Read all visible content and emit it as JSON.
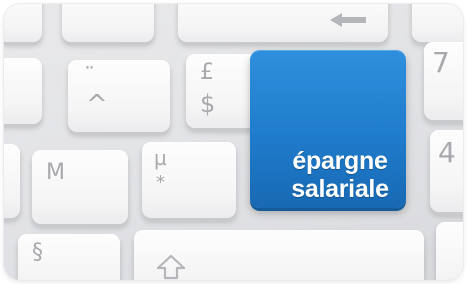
{
  "keyboard": {
    "keys": {
      "colon_key": {
        "top": "¨",
        "bottom": "^"
      },
      "pound_key": {
        "top": "£",
        "bottom": "$"
      },
      "m_key": {
        "label": "M"
      },
      "mu_key": {
        "top": "µ",
        "bottom": "*"
      },
      "section_key": {
        "label": "§"
      },
      "seven_key": {
        "label": "7"
      },
      "four_key": {
        "label": "4"
      },
      "backspace_key": {
        "icon": "left-arrow-icon"
      },
      "shift_key": {
        "icon": "shift-arrow-icon"
      }
    },
    "highlight_key": {
      "line1": "épargne",
      "line2": "salariale",
      "color": "#1f7ccc"
    }
  }
}
